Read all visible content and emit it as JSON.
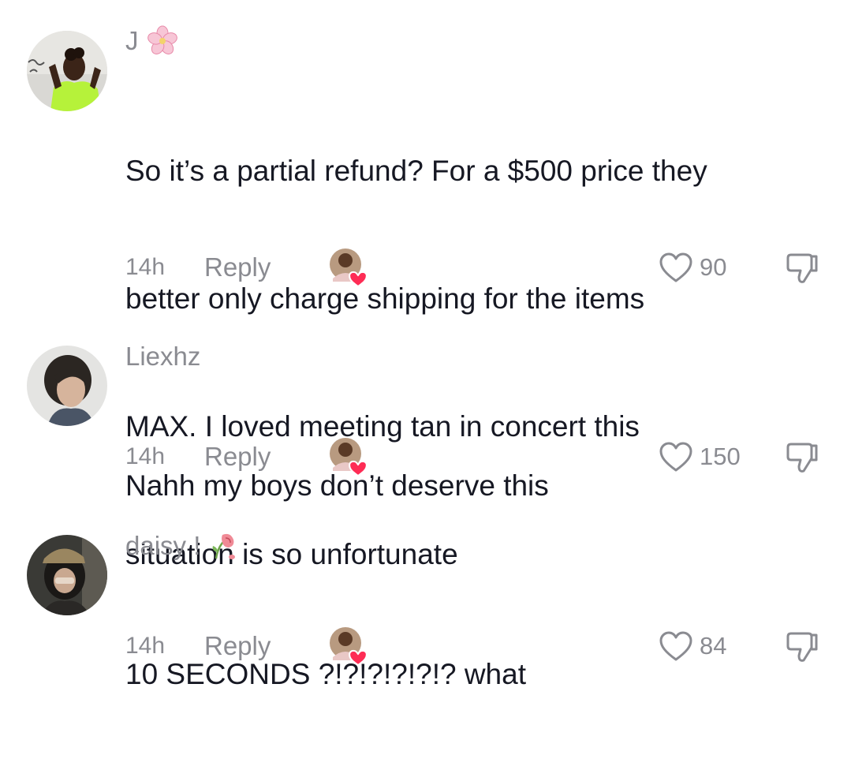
{
  "comments": [
    {
      "username": "J",
      "username_emoji": "cherry-blossom-emoji",
      "lines": [
        "So it’s a partial refund? For a $500 price they",
        "better only charge shipping for the items",
        "MAX. I loved meeting tan in concert this",
        "situation is so unfortunate"
      ],
      "time": "14h",
      "reply_label": "Reply",
      "likes": "90",
      "creator_liked": true
    },
    {
      "username": "Liexhz",
      "lines": [
        "Nahh my boys don’t deserve this"
      ],
      "time": "14h",
      "reply_label": "Reply",
      "likes": "150",
      "creator_liked": true
    },
    {
      "username": "daisy !",
      "username_emoji": "wilted-rose-emoji",
      "lines": [
        "10 SECONDS ?!?!?!?!?!? what"
      ],
      "time": "14h",
      "reply_label": "Reply",
      "likes": "84",
      "creator_liked": true
    }
  ],
  "colors": {
    "primary_text": "#161823",
    "secondary_text": "#8a8b91",
    "heart_red": "#fe2c55"
  },
  "icons": {
    "like": "heart-outline-icon",
    "dislike": "thumbs-down-icon",
    "creator_like": "creator-liked-heart-badge"
  }
}
